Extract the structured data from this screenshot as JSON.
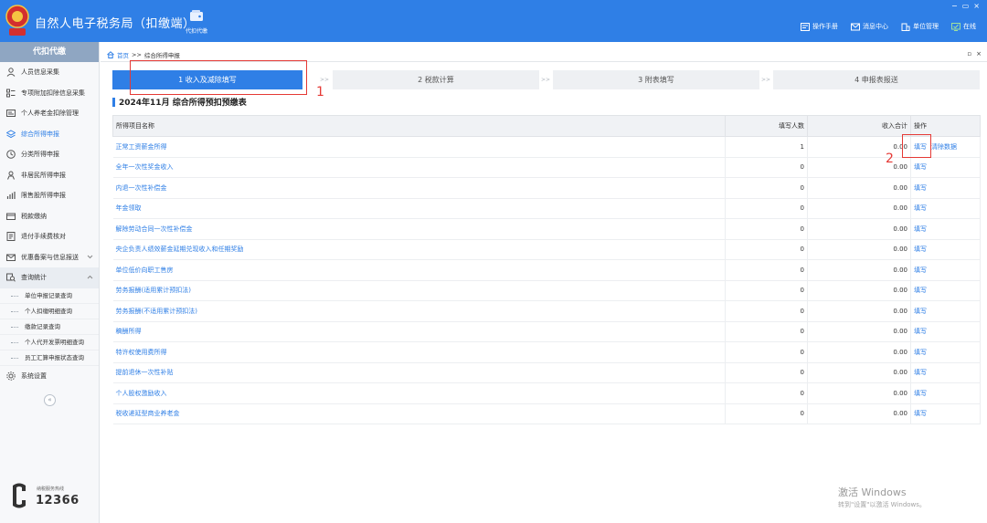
{
  "header": {
    "app_title": "自然人电子税务局（扣缴端）",
    "nav_tile_label": "代扣代缴",
    "tools": [
      {
        "label": "操作手册",
        "icon": "manual-icon"
      },
      {
        "label": "消息中心",
        "icon": "message-icon"
      },
      {
        "label": "单位管理",
        "icon": "building-icon"
      },
      {
        "label": "在线",
        "icon": "online-status-icon"
      }
    ],
    "window_controls": [
      "−",
      "▭",
      "×"
    ]
  },
  "sidebar": {
    "title": "代扣代缴",
    "items": [
      {
        "label": "人员信息采集",
        "icon": "person-icon"
      },
      {
        "label": "专项附加扣除信息采集",
        "icon": "list-icon"
      },
      {
        "label": "个人养老金扣除管理",
        "icon": "card-icon"
      },
      {
        "label": "综合所得申报",
        "icon": "layers-icon",
        "active": true
      },
      {
        "label": "分类所得申报",
        "icon": "clock-icon"
      },
      {
        "label": "非居民所得申报",
        "icon": "user-outline-icon"
      },
      {
        "label": "限售股所得申报",
        "icon": "bar-chart-icon"
      },
      {
        "label": "税款缴纳",
        "icon": "wallet-icon"
      },
      {
        "label": "退付手续费核对",
        "icon": "document-icon"
      },
      {
        "label": "优惠备案与信息报送",
        "icon": "envelope-icon"
      },
      {
        "label": "查询统计",
        "icon": "search-icon"
      }
    ],
    "query_sub_items": [
      "单位申报记录查询",
      "个人扣缴明细查询",
      "缴款记录查询",
      "个人代开发票明细查询",
      "员工汇算申报状态查询"
    ],
    "settings_label": "系统设置",
    "collapse_glyph": "«",
    "hotline_label": "纳税服务热线",
    "hotline_number": "12366"
  },
  "breadcrumb": {
    "home": "首页",
    "separator": ">>",
    "current": "综合所得申报",
    "controls": [
      "▫",
      "×"
    ]
  },
  "steps": [
    {
      "label": "1 收入及减除填写",
      "active": true
    },
    {
      "label": "2 税款计算",
      "active": false
    },
    {
      "label": "3 附表填写",
      "active": false
    },
    {
      "label": "4 申报表报送",
      "active": false
    }
  ],
  "step_arrow": ">>",
  "report_title": "2024年11月  综合所得预扣预缴表",
  "table": {
    "headers": [
      "所得项目名称",
      "填写人数",
      "收入合计",
      "操作"
    ],
    "rows": [
      {
        "name": "正常工资薪金所得",
        "count": "1",
        "income": "0.00",
        "actions": [
          "填写",
          "清除数据"
        ]
      },
      {
        "name": "全年一次性奖金收入",
        "count": "0",
        "income": "0.00",
        "actions": [
          "填写"
        ]
      },
      {
        "name": "内退一次性补偿金",
        "count": "0",
        "income": "0.00",
        "actions": [
          "填写"
        ]
      },
      {
        "name": "年金领取",
        "count": "0",
        "income": "0.00",
        "actions": [
          "填写"
        ]
      },
      {
        "name": "解除劳动合同一次性补偿金",
        "count": "0",
        "income": "0.00",
        "actions": [
          "填写"
        ]
      },
      {
        "name": "央企负责人绩效薪金延期兑现收入和任期奖励",
        "count": "0",
        "income": "0.00",
        "actions": [
          "填写"
        ]
      },
      {
        "name": "单位低价向职工售房",
        "count": "0",
        "income": "0.00",
        "actions": [
          "填写"
        ]
      },
      {
        "name": "劳务报酬(适用累计预扣法)",
        "count": "0",
        "income": "0.00",
        "actions": [
          "填写"
        ]
      },
      {
        "name": "劳务报酬(不适用累计预扣法)",
        "count": "0",
        "income": "0.00",
        "actions": [
          "填写"
        ]
      },
      {
        "name": "稿酬所得",
        "count": "0",
        "income": "0.00",
        "actions": [
          "填写"
        ]
      },
      {
        "name": "特许权使用费所得",
        "count": "0",
        "income": "0.00",
        "actions": [
          "填写"
        ]
      },
      {
        "name": "提前退休一次性补贴",
        "count": "0",
        "income": "0.00",
        "actions": [
          "填写"
        ]
      },
      {
        "name": "个人股权激励收入",
        "count": "0",
        "income": "0.00",
        "actions": [
          "填写"
        ]
      },
      {
        "name": "税收递延型商业养老金",
        "count": "0",
        "income": "0.00",
        "actions": [
          "填写"
        ]
      }
    ]
  },
  "annotations": {
    "num1": "1",
    "num2": "2",
    "color": "#e53935"
  },
  "watermark": {
    "line1": "激活 Windows",
    "line2": "转到\"设置\"以激活 Windows。"
  },
  "colors": {
    "primary": "#2f7fe6",
    "sidebar_header": "#8fa6c2"
  }
}
